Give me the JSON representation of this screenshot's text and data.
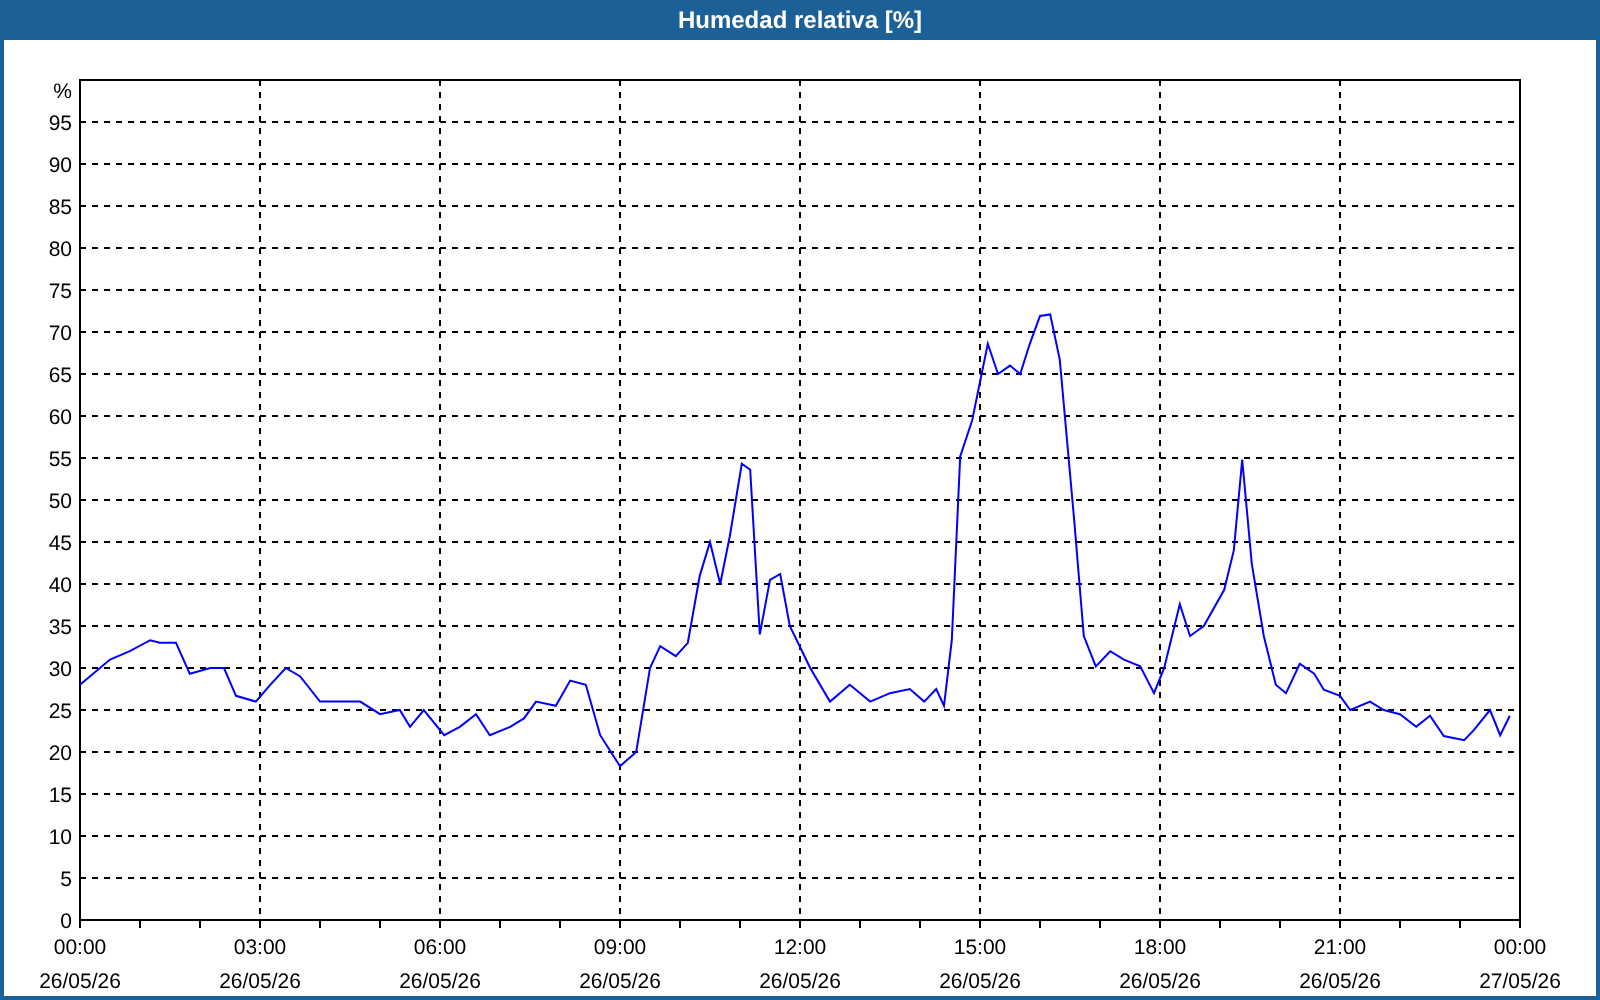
{
  "window": {
    "title": "Humedad relativa [%]"
  },
  "chart_data": {
    "type": "line",
    "ylabel": "%",
    "xlim": [
      0,
      24
    ],
    "ylim": [
      0,
      100
    ],
    "grid": true,
    "yticks": [
      0,
      5,
      10,
      15,
      20,
      25,
      30,
      35,
      40,
      45,
      50,
      55,
      60,
      65,
      70,
      75,
      80,
      85,
      90,
      95
    ],
    "xticks": [
      {
        "value": 0,
        "label": "00:00"
      },
      {
        "value": 3,
        "label": "03:00"
      },
      {
        "value": 6,
        "label": "06:00"
      },
      {
        "value": 9,
        "label": "09:00"
      },
      {
        "value": 12,
        "label": "12:00"
      },
      {
        "value": 15,
        "label": "15:00"
      },
      {
        "value": 18,
        "label": "18:00"
      },
      {
        "value": 21,
        "label": "21:00"
      },
      {
        "value": 24,
        "label": "00:00"
      }
    ],
    "annotations": [
      "26/05/26",
      "26/05/26",
      "26/05/26",
      "26/05/26",
      "26/05/26",
      "26/05/26",
      "26/05/26",
      "26/05/26",
      "27/05/26"
    ],
    "x": [
      0,
      0.5,
      0.83,
      1.17,
      1.33,
      1.6,
      1.83,
      2.17,
      2.4,
      2.6,
      2.93,
      3.17,
      3.43,
      3.67,
      4,
      4.4,
      4.67,
      5,
      5.33,
      5.5,
      5.73,
      6.07,
      6.33,
      6.6,
      6.83,
      7.17,
      7.4,
      7.6,
      7.93,
      8.17,
      8.43,
      8.67,
      9,
      9.27,
      9.5,
      9.67,
      9.93,
      10.13,
      10.33,
      10.5,
      10.67,
      10.83,
      11.03,
      11.17,
      11.33,
      11.5,
      11.67,
      11.83,
      12.17,
      12.5,
      12.83,
      13.17,
      13.5,
      13.83,
      14.07,
      14.27,
      14.4,
      14.53,
      14.67,
      14.87,
      15.13,
      15.3,
      15.5,
      15.67,
      15.83,
      16,
      16.17,
      16.33,
      16.57,
      16.73,
      16.93,
      17.17,
      17.4,
      17.67,
      17.9,
      18.07,
      18.33,
      18.5,
      18.73,
      19.07,
      19.23,
      19.37,
      19.53,
      19.73,
      19.93,
      20.1,
      20.33,
      20.57,
      20.73,
      21,
      21.17,
      21.5,
      21.73,
      22,
      22.27,
      22.5,
      22.73,
      23.07,
      23.23,
      23.5,
      23.67,
      23.83
    ],
    "series": [
      {
        "color": "#0000ff",
        "values": [
          28,
          31,
          32,
          33.3,
          33,
          33,
          29.3,
          30,
          30,
          26.7,
          26,
          28,
          30,
          29,
          26,
          26,
          26,
          24.5,
          25,
          23,
          25,
          22,
          23,
          24.5,
          22,
          23,
          24,
          26,
          25.5,
          28.5,
          28,
          22,
          18.3,
          20,
          30,
          32.6,
          31.4,
          33,
          41,
          45,
          40,
          45.7,
          54.3,
          53.6,
          34,
          40.5,
          41.2,
          35,
          30,
          26,
          28,
          26,
          27,
          27.5,
          26,
          27.5,
          25.5,
          33.3,
          55.2,
          59.5,
          68.6,
          65,
          66,
          65,
          68.6,
          71.9,
          72.1,
          66.7,
          47.6,
          33.8,
          30.2,
          32,
          31,
          30.2,
          27,
          30,
          37.6,
          33.8,
          35,
          39.3,
          44,
          54.8,
          42.4,
          33.8,
          28,
          27,
          30.5,
          29.3,
          27.4,
          26.7,
          25,
          26,
          25,
          24.5,
          23,
          24.3,
          21.9,
          21.4,
          22.6,
          25,
          22,
          24.3
        ]
      }
    ]
  }
}
